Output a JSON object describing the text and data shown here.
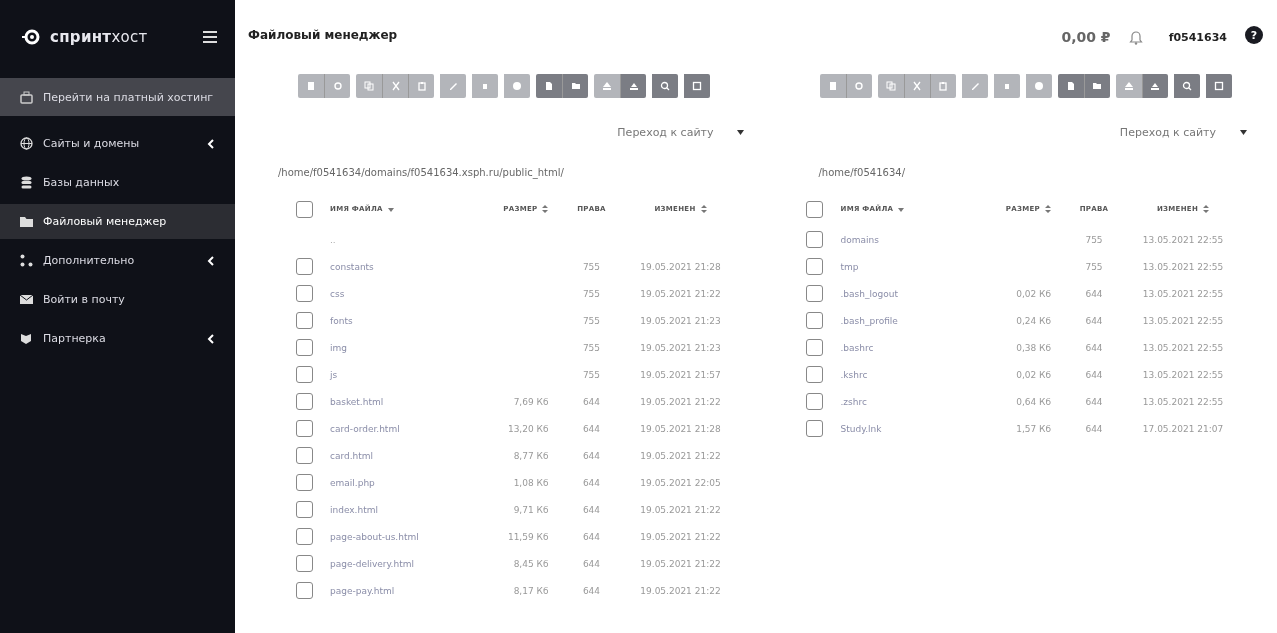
{
  "sidebar": {
    "logo": {
      "bold": "спринт",
      "light": "хост"
    },
    "items": [
      {
        "label": "Перейти на платный хостинг",
        "kind": "promo",
        "selected": false
      },
      {
        "label": "Сайты и домены",
        "kind": "link",
        "has_submenu": true,
        "selected": false
      },
      {
        "label": "Базы данных",
        "kind": "link",
        "has_submenu": false,
        "selected": false
      },
      {
        "label": "Файловый менеджер",
        "kind": "link",
        "has_submenu": false,
        "selected": true
      },
      {
        "label": "Дополнительно",
        "kind": "link",
        "has_submenu": true,
        "selected": false
      },
      {
        "label": "Войти в почту",
        "kind": "link",
        "has_submenu": false,
        "selected": false
      },
      {
        "label": "Партнерка",
        "kind": "link",
        "has_submenu": true,
        "selected": false
      }
    ]
  },
  "header": {
    "title": "Файловый менеджер",
    "balance": "0,00 ₽",
    "user": "f0541634",
    "help": "?"
  },
  "panels": [
    {
      "toolbar": [
        [
          {
            "kind": "file",
            "disabled": true
          },
          {
            "kind": "view",
            "disabled": true
          }
        ],
        [
          {
            "kind": "copy",
            "disabled": true
          },
          {
            "kind": "cut",
            "disabled": true
          },
          {
            "kind": "paste",
            "disabled": true
          }
        ],
        [
          {
            "kind": "rename",
            "disabled": true
          }
        ],
        [
          {
            "kind": "delete",
            "disabled": true
          }
        ],
        [
          {
            "kind": "info",
            "disabled": true
          }
        ],
        [
          {
            "kind": "new-file",
            "disabled": false
          },
          {
            "kind": "new-folder",
            "disabled": false
          }
        ],
        [
          {
            "kind": "upload",
            "disabled": true
          },
          {
            "kind": "download",
            "disabled": false
          }
        ],
        [
          {
            "kind": "search",
            "disabled": false
          }
        ],
        [
          {
            "kind": "settings",
            "disabled": false
          }
        ]
      ],
      "site_select": "Переход к сайту",
      "path": "/home/f0541634/domains/f0541634.xsph.ru/public_html/",
      "all_checked": false,
      "columns": [
        {
          "label": "ИМЯ ФАЙЛА",
          "sortable": true,
          "sorted": true
        },
        {
          "label": "РАЗМЕР",
          "sortable": true,
          "sorted": false
        },
        {
          "label": "ПРАВА",
          "sortable": false
        },
        {
          "label": "ИЗМЕНЕН",
          "sortable": true,
          "sorted": false
        }
      ],
      "rows": [
        {
          "kind": "parent",
          "name": ".."
        },
        {
          "kind": "entry",
          "checked": false,
          "name": "constants",
          "perms": "755",
          "modified": "19.05.2021 21:28"
        },
        {
          "kind": "entry",
          "checked": false,
          "name": "css",
          "perms": "755",
          "modified": "19.05.2021 21:22"
        },
        {
          "kind": "entry",
          "checked": false,
          "name": "fonts",
          "perms": "755",
          "modified": "19.05.2021 21:23"
        },
        {
          "kind": "entry",
          "checked": false,
          "name": "img",
          "perms": "755",
          "modified": "19.05.2021 21:23"
        },
        {
          "kind": "entry",
          "checked": false,
          "name": "js",
          "perms": "755",
          "modified": "19.05.2021 21:57"
        },
        {
          "kind": "entry",
          "checked": false,
          "name": "basket.html",
          "size": "7,69 Кб",
          "perms": "644",
          "modified": "19.05.2021 21:22"
        },
        {
          "kind": "entry",
          "checked": false,
          "name": "card-order.html",
          "size": "13,20 Кб",
          "perms": "644",
          "modified": "19.05.2021 21:28"
        },
        {
          "kind": "entry",
          "checked": false,
          "name": "card.html",
          "size": "8,77 Кб",
          "perms": "644",
          "modified": "19.05.2021 21:22"
        },
        {
          "kind": "entry",
          "checked": false,
          "name": "email.php",
          "size": "1,08 Кб",
          "perms": "644",
          "modified": "19.05.2021 22:05"
        },
        {
          "kind": "entry",
          "checked": false,
          "name": "index.html",
          "size": "9,71 Кб",
          "perms": "644",
          "modified": "19.05.2021 21:22"
        },
        {
          "kind": "entry",
          "checked": false,
          "name": "page-about-us.html",
          "size": "11,59 Кб",
          "perms": "644",
          "modified": "19.05.2021 21:22"
        },
        {
          "kind": "entry",
          "checked": false,
          "name": "page-delivery.html",
          "size": "8,45 Кб",
          "perms": "644",
          "modified": "19.05.2021 21:22"
        },
        {
          "kind": "entry",
          "checked": false,
          "name": "page-pay.html",
          "size": "8,17 Кб",
          "perms": "644",
          "modified": "19.05.2021 21:22"
        }
      ]
    },
    {
      "toolbar": [
        [
          {
            "kind": "file",
            "disabled": true
          },
          {
            "kind": "view",
            "disabled": true
          }
        ],
        [
          {
            "kind": "copy",
            "disabled": true
          },
          {
            "kind": "cut",
            "disabled": true
          },
          {
            "kind": "paste",
            "disabled": true
          }
        ],
        [
          {
            "kind": "rename",
            "disabled": true
          }
        ],
        [
          {
            "kind": "delete",
            "disabled": true
          }
        ],
        [
          {
            "kind": "info",
            "disabled": true
          }
        ],
        [
          {
            "kind": "new-file",
            "disabled": false
          },
          {
            "kind": "new-folder",
            "disabled": false
          }
        ],
        [
          {
            "kind": "upload",
            "disabled": true
          },
          {
            "kind": "download",
            "disabled": false
          }
        ],
        [
          {
            "kind": "search",
            "disabled": false
          }
        ],
        [
          {
            "kind": "settings",
            "disabled": false
          }
        ]
      ],
      "site_select": "Переход к сайту",
      "path": "/home/f0541634/",
      "all_checked": false,
      "columns": [
        {
          "label": "ИМЯ ФАЙЛА",
          "sortable": true,
          "sorted": true
        },
        {
          "label": "РАЗМЕР",
          "sortable": true,
          "sorted": false
        },
        {
          "label": "ПРАВА",
          "sortable": false
        },
        {
          "label": "ИЗМЕНЕН",
          "sortable": true,
          "sorted": false
        }
      ],
      "rows": [
        {
          "kind": "entry",
          "checked": false,
          "name": "domains",
          "perms": "755",
          "modified": "13.05.2021 22:55"
        },
        {
          "kind": "entry",
          "checked": false,
          "name": "tmp",
          "perms": "755",
          "modified": "13.05.2021 22:55"
        },
        {
          "kind": "entry",
          "checked": false,
          "name": ".bash_logout",
          "size": "0,02 Кб",
          "perms": "644",
          "modified": "13.05.2021 22:55"
        },
        {
          "kind": "entry",
          "checked": false,
          "name": ".bash_profile",
          "size": "0,24 Кб",
          "perms": "644",
          "modified": "13.05.2021 22:55"
        },
        {
          "kind": "entry",
          "checked": false,
          "name": ".bashrc",
          "size": "0,38 Кб",
          "perms": "644",
          "modified": "13.05.2021 22:55"
        },
        {
          "kind": "entry",
          "checked": false,
          "name": ".kshrc",
          "size": "0,02 Кб",
          "perms": "644",
          "modified": "13.05.2021 22:55"
        },
        {
          "kind": "entry",
          "checked": false,
          "name": ".zshrc",
          "size": "0,64 Кб",
          "perms": "644",
          "modified": "13.05.2021 22:55"
        },
        {
          "kind": "entry",
          "checked": false,
          "name": "Study.lnk",
          "size": "1,57 Кб",
          "perms": "644",
          "modified": "17.05.2021 21:07"
        }
      ]
    }
  ]
}
